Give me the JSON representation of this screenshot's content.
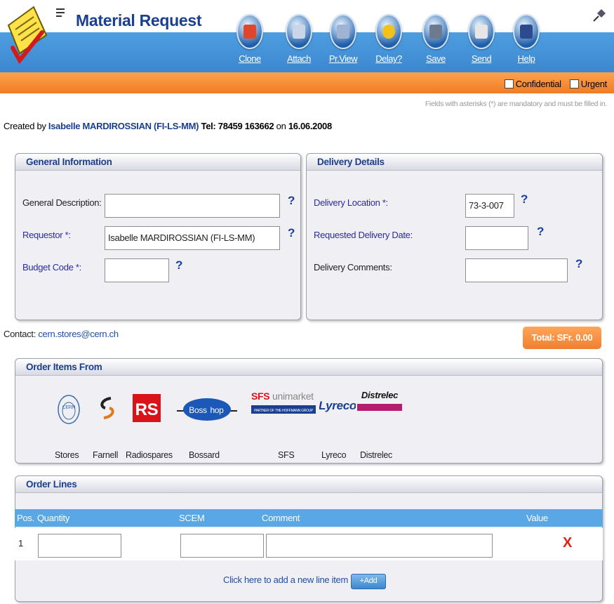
{
  "header": {
    "title": "Material Request",
    "toolbar": [
      {
        "key": "clone",
        "label": "Clone",
        "icon": "clone-icon",
        "color": "#e2452d"
      },
      {
        "key": "attach",
        "label": "Attach",
        "icon": "paperclip-icon",
        "color": "#c8d6e8"
      },
      {
        "key": "preview",
        "label": "Pr.View",
        "icon": "printer-icon",
        "color": "#9fb4d4"
      },
      {
        "key": "delay",
        "label": "Delay?",
        "icon": "alarm-clock-icon",
        "color": "#f2c21b"
      },
      {
        "key": "save",
        "label": "Save",
        "icon": "floppy-disk-icon",
        "color": "#6e7a8f"
      },
      {
        "key": "send",
        "label": "Send",
        "icon": "envelope-icon",
        "color": "#e6e6e6"
      },
      {
        "key": "help",
        "label": "Help",
        "icon": "help-book-icon",
        "color": "#2d4a8f"
      }
    ],
    "confidential_label": "Confidential",
    "urgent_label": "Urgent",
    "mandatory_note": "Fields with asterisks (*) are mandatory and must be filled in."
  },
  "created": {
    "prefix": "Created by",
    "name": "Isabelle MARDIROSSIAN (FI-LS-MM)",
    "tel": "Tel: 78459 163662",
    "on": "on",
    "date": "16.06.2008"
  },
  "general": {
    "title": "General Information",
    "description_label": "General Description:",
    "description_value": "",
    "requestor_label": "Requestor *:",
    "requestor_value": "Isabelle MARDIROSSIAN (FI-LS-MM)",
    "budget_label": "Budget Code *:",
    "budget_value": ""
  },
  "delivery": {
    "title": "Delivery Details",
    "location_label": "Delivery Location *:",
    "location_value": "73-3-007",
    "date_label": "Requested Delivery Date:",
    "date_value": "",
    "comments_label": "Delivery Comments:",
    "comments_value": ""
  },
  "help_glyph": "?",
  "contact": {
    "label": "Contact:",
    "email": "cern.stores@cern.ch"
  },
  "total": "Total: SFr. 0.00",
  "order_from": {
    "title": "Order Items From",
    "vendors": [
      "Stores",
      "Farnell",
      "Radiospares",
      "Bossard",
      "SFS",
      "Lyreco",
      "Distrelec"
    ],
    "logos": {
      "cern": "CERN",
      "rs": "RS",
      "boss_a": "Boss",
      "boss_b": "hop",
      "sfs_a": "SFS",
      "sfs_b": "unimarket",
      "sfs_c": "PARTNER OF THE HOFFMANN GROUP",
      "lyreco": "Lyreco",
      "distrelec": "Distrelec"
    }
  },
  "order_lines": {
    "title": "Order Lines",
    "columns": {
      "pos": "Pos.",
      "quantity": "Quantity",
      "scem": "SCEM",
      "comment": "Comment",
      "value": "Value"
    },
    "rows": [
      {
        "pos": "1",
        "quantity": "",
        "scem": "",
        "comment": ""
      }
    ],
    "delete_glyph": "X",
    "add_text": "Click here to add a new line item",
    "add_button": "+Add"
  }
}
